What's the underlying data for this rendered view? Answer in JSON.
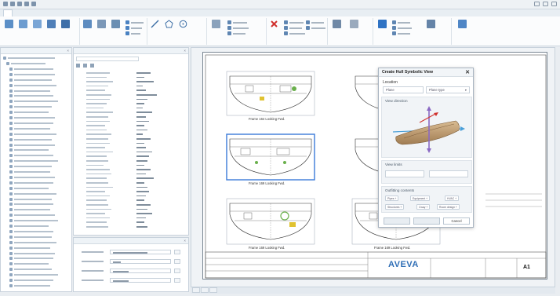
{
  "app": {
    "title": ""
  },
  "ribbon": {
    "tabs": [
      "",
      "",
      "",
      "",
      "",
      "",
      "",
      "",
      ""
    ],
    "buttons": [
      "",
      "",
      "",
      "",
      "",
      "",
      "",
      "",
      "",
      "",
      "",
      "",
      "",
      "",
      "",
      "",
      "",
      "",
      "",
      ""
    ],
    "group_labels": [
      "",
      "",
      "",
      "",
      "",
      "",
      ""
    ]
  },
  "tree_panel": {
    "title": "",
    "items": [
      "",
      "",
      "",
      "",
      "",
      "",
      "",
      "",
      "",
      "",
      "",
      "",
      "",
      "",
      "",
      "",
      "",
      "",
      "",
      "",
      "",
      "",
      "",
      "",
      "",
      "",
      "",
      "",
      "",
      "",
      "",
      "",
      "",
      "",
      "",
      "",
      "",
      "",
      "",
      "",
      "",
      "",
      ""
    ]
  },
  "properties_panel": {
    "title": "",
    "rows": 36
  },
  "bottom_panel": {
    "title": "",
    "rows": [
      "",
      "",
      "",
      ""
    ]
  },
  "drawing": {
    "captions": [
      "Frame 164 Looking Fwd.",
      "Frame 169 Looking Fwd.",
      "Frame 169 Looking Fwd.",
      "Frame 169 Looking Fwd."
    ],
    "logo": "AVEVA",
    "sheet_id": "A1"
  },
  "sheet_tabs": [
    "",
    "",
    ""
  ],
  "dialog": {
    "title": "Create Hull Symbolic View",
    "location_label": "Location",
    "plane_value": "Plane",
    "plane_type": "Plane type",
    "view_direction_label": "View direction",
    "view_limits_label": "View limits",
    "outfitting_label": "Outfitting contents",
    "chips": [
      "Pipes",
      "Equipment",
      "HVAC",
      "Structures",
      "Cway",
      "Room design"
    ],
    "preview_button": "",
    "create_button": "",
    "cancel_button": "Cancel"
  },
  "colors": {
    "accent": "#2d6db5",
    "hull_fill": "#c9a77e",
    "axis_vertical": "#8a69c4",
    "axis_horizontal": "#4a9fd8",
    "highlight_frame": "#3b7bd9",
    "equipment_green": "#6ab04c"
  }
}
